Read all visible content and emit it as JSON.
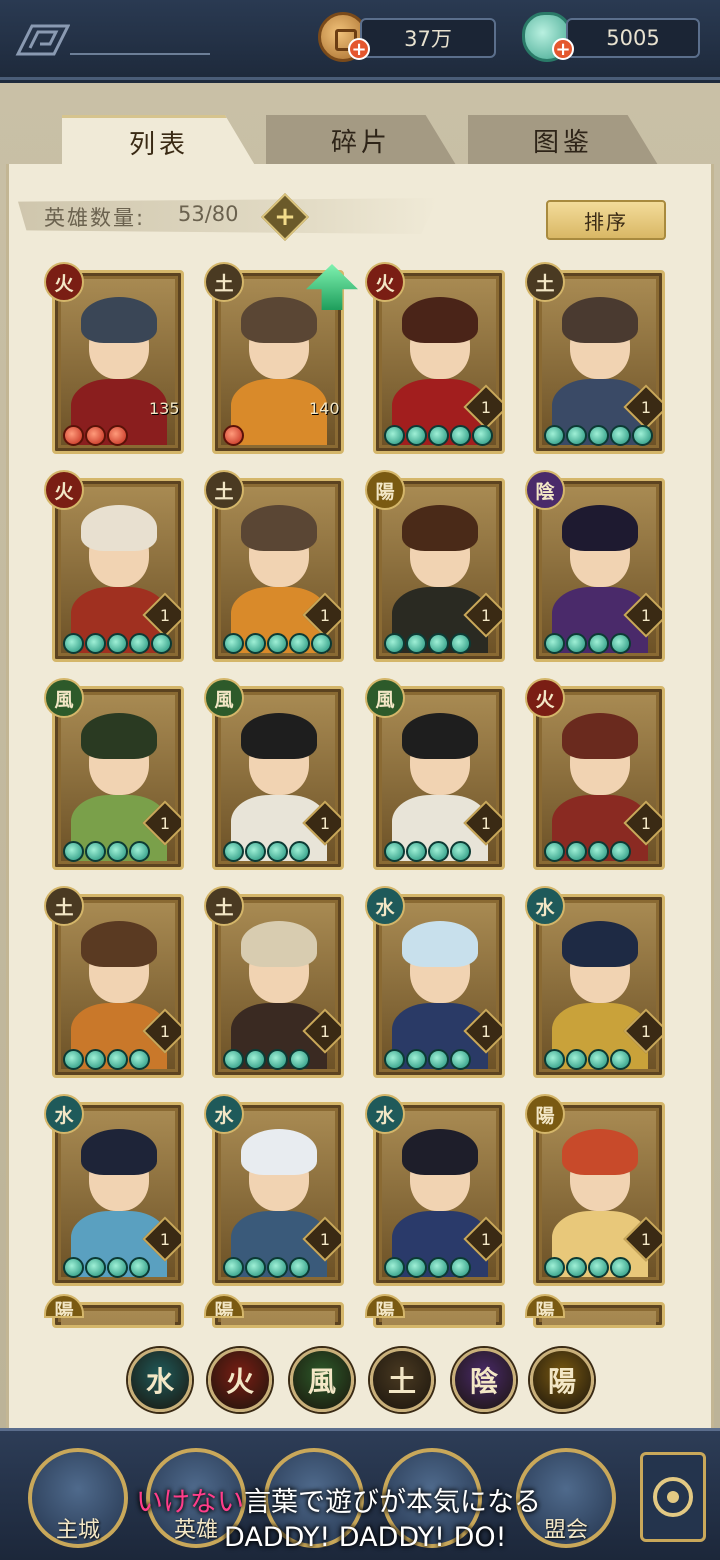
{
  "currency": {
    "coins": "37万",
    "jade": "5005"
  },
  "tabs": [
    {
      "label": "列表",
      "active": true
    },
    {
      "label": "碎片",
      "active": false
    },
    {
      "label": "图鉴",
      "active": false
    }
  ],
  "hero_count": {
    "label": "英雄数量:",
    "value": "53/80"
  },
  "sort_label": "排序",
  "elements": {
    "water": {
      "glyph": "水",
      "color": "#1f5a5a"
    },
    "fire": {
      "glyph": "火",
      "color": "#7a1e14"
    },
    "wind": {
      "glyph": "風",
      "color": "#2d5a2a"
    },
    "earth": {
      "glyph": "土",
      "color": "#4a3a22"
    },
    "yin": {
      "glyph": "陰",
      "color": "#4a2a6a"
    },
    "yang": {
      "glyph": "陽",
      "color": "#7a5a12"
    }
  },
  "heroes": [
    {
      "element": "fire",
      "level": "135",
      "stars": 3,
      "star_color": "red",
      "hair": "#3a4656",
      "body": "#8a1e1e"
    },
    {
      "element": "earth",
      "level": "140",
      "stars": 1,
      "star_color": "red",
      "hair": "#5a4634",
      "body": "#d98a2a"
    },
    {
      "element": "fire",
      "level": "1",
      "stars": 5,
      "star_color": "jade",
      "hair": "#4a2418",
      "body": "#a21e1e"
    },
    {
      "element": "earth",
      "level": "1",
      "stars": 5,
      "star_color": "jade",
      "hair": "#4a3a30",
      "body": "#3a4a66"
    },
    {
      "element": "fire",
      "level": "1",
      "stars": 5,
      "star_color": "jade",
      "hair": "#e8e0d0",
      "body": "#a03020"
    },
    {
      "element": "earth",
      "level": "1",
      "stars": 5,
      "star_color": "jade",
      "hair": "#5a4634",
      "body": "#d98a2a"
    },
    {
      "element": "yang",
      "level": "1",
      "stars": 4,
      "star_color": "jade",
      "hair": "#4a2a18",
      "body": "#2a2a22"
    },
    {
      "element": "yin",
      "level": "1",
      "stars": 4,
      "star_color": "jade",
      "hair": "#1e1a30",
      "body": "#4a2a6a"
    },
    {
      "element": "wind",
      "level": "1",
      "stars": 4,
      "star_color": "jade",
      "hair": "#2a3a22",
      "body": "#7aa04a"
    },
    {
      "element": "wind",
      "level": "1",
      "stars": 4,
      "star_color": "jade",
      "hair": "#1e1e1e",
      "body": "#e8e4d8"
    },
    {
      "element": "wind",
      "level": "1",
      "stars": 4,
      "star_color": "jade",
      "hair": "#1e1e1e",
      "body": "#e8e4d8"
    },
    {
      "element": "fire",
      "level": "1",
      "stars": 4,
      "star_color": "jade",
      "hair": "#6a2a1e",
      "body": "#8a2a22"
    },
    {
      "element": "earth",
      "level": "1",
      "stars": 4,
      "star_color": "jade",
      "hair": "#5a3a22",
      "body": "#c9782a"
    },
    {
      "element": "earth",
      "level": "1",
      "stars": 4,
      "star_color": "jade",
      "hair": "#d8ccb0",
      "body": "#3a2a22"
    },
    {
      "element": "water",
      "level": "1",
      "stars": 4,
      "star_color": "jade",
      "hair": "#c8e0ec",
      "body": "#2a3a66"
    },
    {
      "element": "water",
      "level": "1",
      "stars": 4,
      "star_color": "jade",
      "hair": "#1e2a44",
      "body": "#c9a23a"
    },
    {
      "element": "water",
      "level": "1",
      "stars": 4,
      "star_color": "jade",
      "hair": "#1e2438",
      "body": "#5aa0c0"
    },
    {
      "element": "water",
      "level": "1",
      "stars": 4,
      "star_color": "jade",
      "hair": "#e8ecf0",
      "body": "#3a5a7a"
    },
    {
      "element": "water",
      "level": "1",
      "stars": 4,
      "star_color": "jade",
      "hair": "#1e1e2a",
      "body": "#2a3a6a"
    },
    {
      "element": "yang",
      "level": "1",
      "stars": 4,
      "star_color": "jade",
      "hair": "#c84a2a",
      "body": "#e8c87a"
    },
    {
      "element": "yang",
      "level": "",
      "stars": 0,
      "star_color": "jade",
      "hair": "#8a6a33",
      "body": "#8a6a33"
    },
    {
      "element": "yang",
      "level": "",
      "stars": 0,
      "star_color": "jade",
      "hair": "#8a6a33",
      "body": "#8a6a33"
    },
    {
      "element": "yang",
      "level": "",
      "stars": 0,
      "star_color": "jade",
      "hair": "#8a6a33",
      "body": "#8a6a33"
    },
    {
      "element": "yang",
      "level": "",
      "stars": 0,
      "star_color": "jade",
      "hair": "#8a6a33",
      "body": "#8a6a33"
    }
  ],
  "filters": [
    "water",
    "fire",
    "wind",
    "earth",
    "yin",
    "yang"
  ],
  "nav": {
    "city": "主城",
    "heroes": "英雄",
    "alliance": "盟会"
  },
  "lyrics": {
    "line1_highlight": "いけない",
    "line1_rest": "言葉で遊びが本気になる",
    "line2": "DADDY! DADDY! DO!"
  }
}
